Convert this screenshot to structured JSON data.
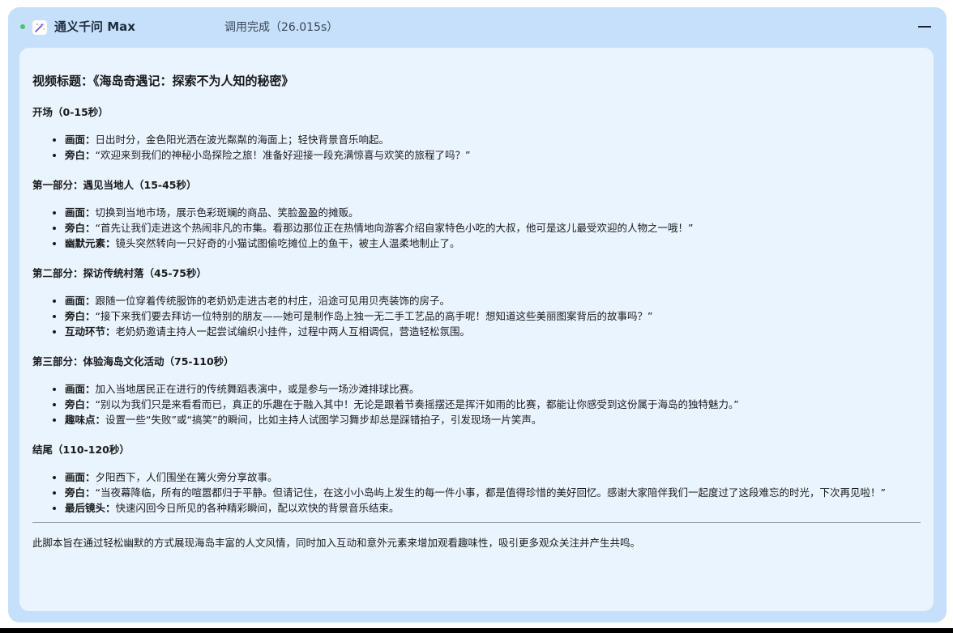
{
  "header": {
    "app_title": "通义千问 Max",
    "status": "调用完成（26.015s）",
    "app_icon": "wand-sparkle-icon",
    "collapse_icon": "minus-icon",
    "status_color": "#44c767"
  },
  "content": {
    "video_title": "视频标题：《海岛奇遇记：探索不为人知的秘密》",
    "sections": [
      {
        "heading": "开场（0-15秒）",
        "items": [
          {
            "label": "画面",
            "sep": "：",
            "text": "日出时分，金色阳光洒在波光粼粼的海面上；轻快背景音乐响起。"
          },
          {
            "label": "旁白",
            "sep": "：",
            "text": "“欢迎来到我们的神秘小岛探险之旅！准备好迎接一段充满惊喜与欢笑的旅程了吗？”"
          }
        ]
      },
      {
        "heading": "第一部分：遇见当地人（15-45秒）",
        "items": [
          {
            "label": "画面",
            "sep": "：",
            "text": "切换到当地市场，展示色彩斑斓的商品、笑脸盈盈的摊贩。"
          },
          {
            "label": "旁白",
            "sep": "：",
            "text": "“首先让我们走进这个热闹非凡的市集。看那边那位正在热情地向游客介绍自家特色小吃的大叔，他可是这儿最受欢迎的人物之一哦！”"
          },
          {
            "label": "幽默元素",
            "sep": "：",
            "text": "镜头突然转向一只好奇的小猫试图偷吃摊位上的鱼干，被主人温柔地制止了。"
          }
        ]
      },
      {
        "heading": "第二部分：探访传统村落（45-75秒）",
        "items": [
          {
            "label": "画面",
            "sep": "：",
            "text": "跟随一位穿着传统服饰的老奶奶走进古老的村庄，沿途可见用贝壳装饰的房子。"
          },
          {
            "label": "旁白",
            "sep": "：",
            "text": "“接下来我们要去拜访一位特别的朋友——她可是制作岛上独一无二手工艺品的高手呢！想知道这些美丽图案背后的故事吗？”"
          },
          {
            "label": "互动环节",
            "sep": "：",
            "text": "老奶奶邀请主持人一起尝试编织小挂件，过程中两人互相调侃，营造轻松氛围。"
          }
        ]
      },
      {
        "heading": "第三部分：体验海岛文化活动（75-110秒）",
        "items": [
          {
            "label": "画面",
            "sep": "：",
            "text": "加入当地居民正在进行的传统舞蹈表演中，或是参与一场沙滩排球比赛。"
          },
          {
            "label": "旁白",
            "sep": "：",
            "text": "“别以为我们只是来看看而已，真正的乐趣在于融入其中！无论是跟着节奏摇摆还是挥汗如雨的比赛，都能让你感受到这份属于海岛的独特魅力。”"
          },
          {
            "label": "趣味点",
            "sep": "：",
            "text": "设置一些“失败”或“搞笑”的瞬间，比如主持人试图学习舞步却总是踩错拍子，引发现场一片笑声。"
          }
        ]
      },
      {
        "heading": "结尾（110-120秒）",
        "items": [
          {
            "label": "画面",
            "sep": "：",
            "text": "夕阳西下，人们围坐在篝火旁分享故事。"
          },
          {
            "label": "旁白",
            "sep": "：",
            "text": "“当夜幕降临，所有的喧嚣都归于平静。但请记住，在这小小岛屿上发生的每一件小事，都是值得珍惜的美好回忆。感谢大家陪伴我们一起度过了这段难忘的时光，下次再见啦！”"
          },
          {
            "label": "最后镜头",
            "sep": "：",
            "text": "快速闪回今日所见的各种精彩瞬间，配以欢快的背景音乐结束。"
          }
        ]
      }
    ],
    "closing": "此脚本旨在通过轻松幽默的方式展现海岛丰富的人文风情，同时加入互动和意外元素来增加观看趣味性，吸引更多观众关注并产生共鸣。"
  }
}
